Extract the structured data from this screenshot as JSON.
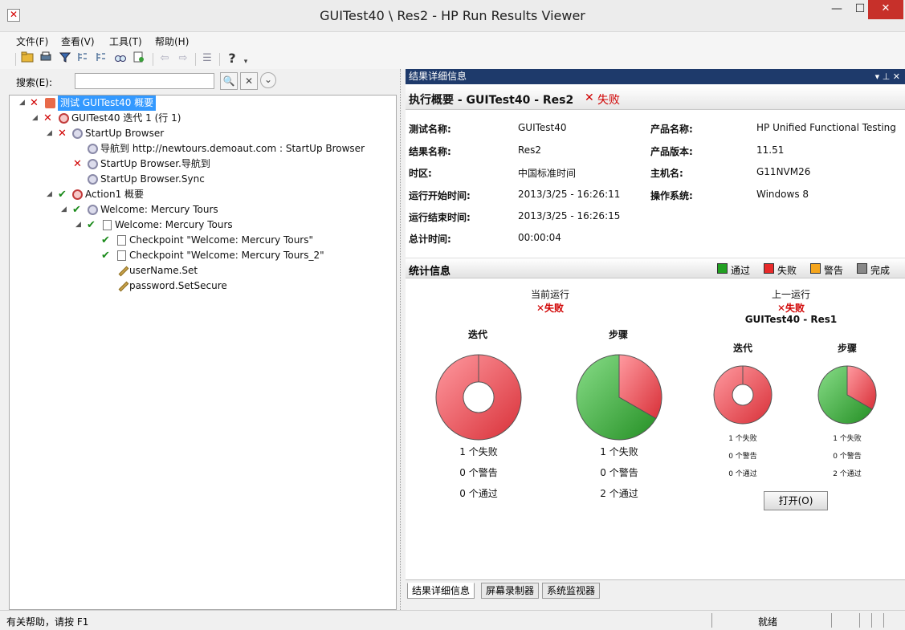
{
  "window": {
    "title": "GUITest40 \\ Res2 - HP Run Results Viewer",
    "min": "—",
    "max": "☐",
    "close": "✕"
  },
  "menu": {
    "file": "文件(F)",
    "view": "查看(V)",
    "tools": "工具(T)",
    "help": "帮助(H)"
  },
  "toolbar": {
    "icons": [
      "open-folder-icon",
      "print-icon",
      "filter-icon",
      "expand-all-icon",
      "collapse-all-icon",
      "find-icon",
      "export-icon",
      "back-icon",
      "forward-icon",
      "list-icon",
      "help-icon"
    ]
  },
  "search": {
    "label": "搜索(E):",
    "value": "",
    "search_btn": "🔍",
    "clear_btn": "✕",
    "options_btn": "⌄"
  },
  "tree": {
    "nodes": [
      {
        "label": "测试 GUITest40 概要",
        "status": "fail"
      },
      {
        "label": "GUITest40 迭代 1 (行 1)",
        "status": "fail"
      },
      {
        "label": "StartUp Browser",
        "status": "fail"
      },
      {
        "label": "导航到 http://newtours.demoaut.com  : StartUp Browser",
        "status": ""
      },
      {
        "label": "StartUp Browser.导航到",
        "status": "fail"
      },
      {
        "label": "StartUp Browser.Sync",
        "status": ""
      },
      {
        "label": "Action1 概要",
        "status": "pass"
      },
      {
        "label": "Welcome: Mercury Tours",
        "status": "pass"
      },
      {
        "label": "Welcome: Mercury Tours",
        "status": "pass"
      },
      {
        "label": "Checkpoint \"Welcome: Mercury Tours\"",
        "status": "pass"
      },
      {
        "label": "Checkpoint \"Welcome: Mercury Tours_2\"",
        "status": "pass"
      },
      {
        "label": "userName.Set",
        "status": ""
      },
      {
        "label": "password.SetSecure",
        "status": ""
      }
    ]
  },
  "results": {
    "header": "结果详细信息",
    "header_ctrl": "▾ ⊥ ✕",
    "exec_title": "执行概要 - GUITest40 - Res2",
    "exec_status_mark": "✕",
    "exec_status": "失败",
    "info": {
      "test_name_label": "测试名称:",
      "test_name": "GUITest40",
      "result_name_label": "结果名称:",
      "result_name": "Res2",
      "timezone_label": "时区:",
      "timezone": "中国标准时间",
      "start_label": "运行开始时间:",
      "start": "2013/3/25 - 16:26:11",
      "end_label": "运行结束时间:",
      "end": "2013/3/25 - 16:26:15",
      "total_label": "总计时间:",
      "total": "00:00:04",
      "product_label": "产品名称:",
      "product": "HP Unified Functional Testing",
      "version_label": "产品版本:",
      "version": "11.51",
      "host_label": "主机名:",
      "host": "G11NVM26",
      "os_label": "操作系统:",
      "os": "Windows 8"
    },
    "stats": {
      "title": "统计信息",
      "legend": [
        {
          "label": "通过",
          "color": "#22a022"
        },
        {
          "label": "失败",
          "color": "#e82a2a"
        },
        {
          "label": "警告",
          "color": "#f5a51c"
        },
        {
          "label": "完成",
          "color": "#888888"
        }
      ],
      "current": {
        "title": "当前运行",
        "status": "✕失败",
        "iter_title": "迭代",
        "step_title": "步骤",
        "iter_fail": "1 个失败",
        "iter_warn": "0 个警告",
        "iter_pass": "0 个通过",
        "step_fail": "1 个失败",
        "step_warn": "0 个警告",
        "step_pass": "2 个通过"
      },
      "previous": {
        "title": "上一运行",
        "status": "✕失败",
        "name": "GUITest40 - Res1",
        "iter_title": "迭代",
        "step_title": "步骤",
        "iter_fail": "1 个失败",
        "iter_warn": "0 个警告",
        "iter_pass": "0 个通过",
        "step_fail": "1 个失败",
        "step_warn": "0 个警告",
        "step_pass": "2 个通过"
      },
      "open_btn": "打开(O)"
    },
    "tabs": [
      "结果详细信息",
      "屏幕录制器",
      "系统监视器"
    ]
  },
  "chart_data": [
    {
      "type": "pie",
      "title": "迭代",
      "categories": [
        "失败",
        "通过"
      ],
      "values": [
        1,
        0
      ]
    },
    {
      "type": "pie",
      "title": "步骤",
      "categories": [
        "失败",
        "通过"
      ],
      "values": [
        1,
        2
      ]
    }
  ],
  "statusbar": {
    "help": "有关帮助，请按 F1",
    "ready": "就绪"
  }
}
